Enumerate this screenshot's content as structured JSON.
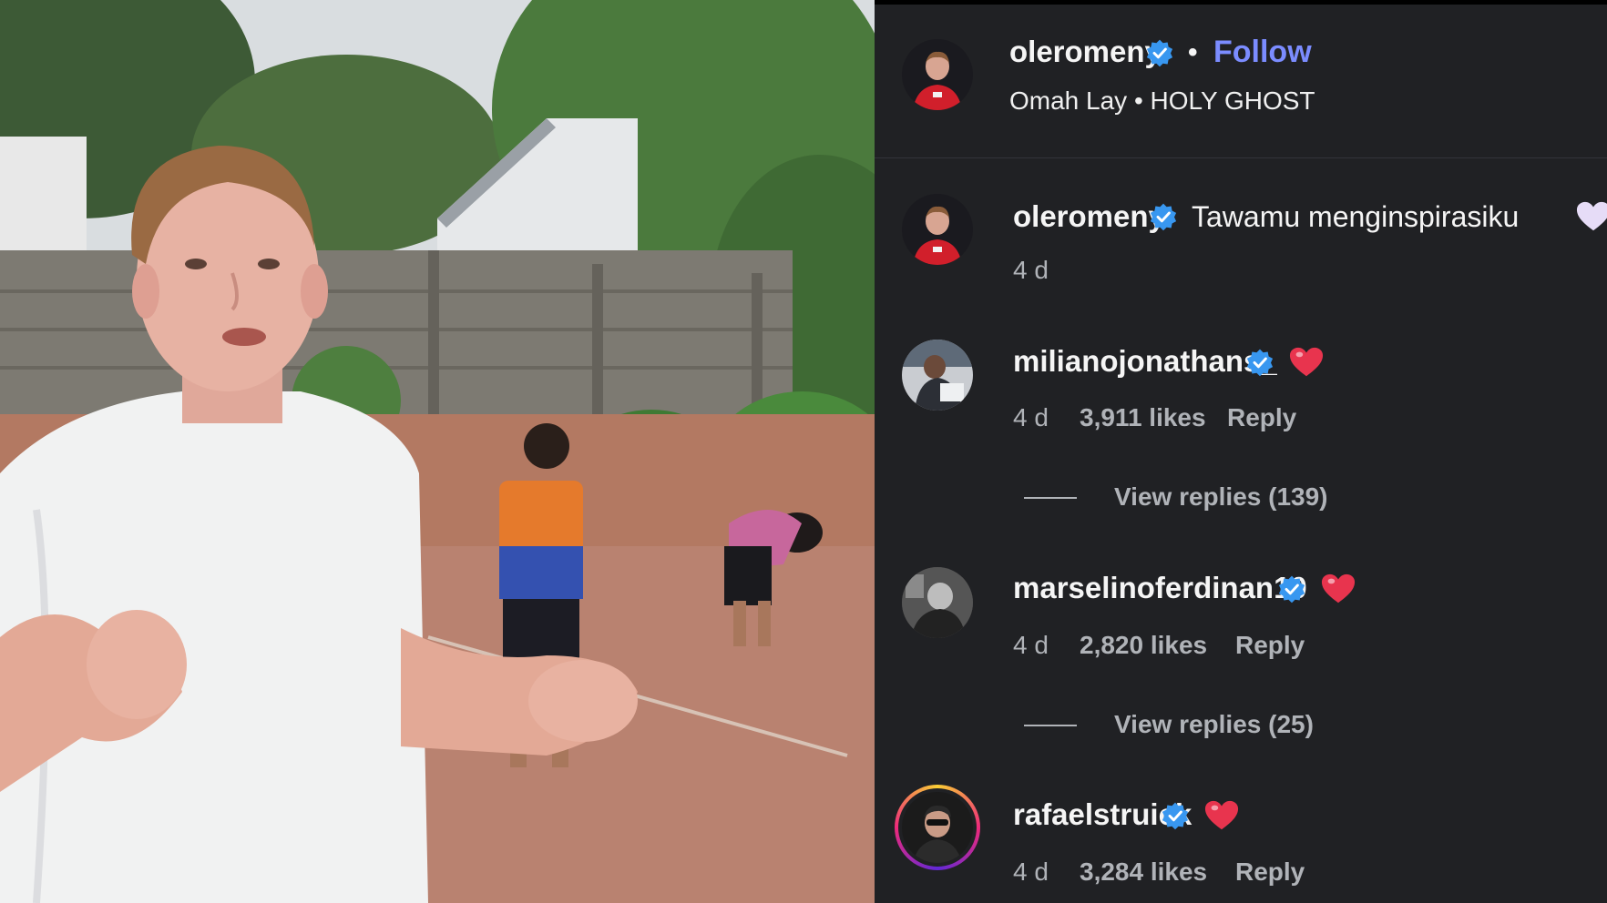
{
  "post": {
    "author": "oleromeny",
    "separator": "•",
    "follow_label": "Follow",
    "music": "Omah Lay • HOLY GHOST"
  },
  "comments": [
    {
      "username": "oleromeny",
      "text": "Tawamu menginspirasiku",
      "emoji": "light-purple-heart",
      "time": "4 d"
    },
    {
      "username": "milianojonathans_",
      "emoji": "red-heart",
      "time": "4 d",
      "likes": "3,911 likes",
      "reply_label": "Reply",
      "view_replies": "View replies (139)"
    },
    {
      "username": "marselinoferdinan10",
      "emoji": "red-heart",
      "time": "4 d",
      "likes": "2,820 likes",
      "reply_label": "Reply",
      "view_replies": "View replies (25)"
    },
    {
      "username": "rafaelstruick",
      "emoji": "red-heart",
      "time": "4 d",
      "likes": "3,284 likes",
      "reply_label": "Reply"
    }
  ],
  "icons": {
    "verified": "verified-badge-icon",
    "heart": "heart-emoji-icon"
  },
  "colors": {
    "panel_bg": "#202124",
    "accent_follow": "#7b8cff",
    "verified_blue": "#3897f0",
    "heart_red": "#e8344e",
    "muted_text": "#b0b3b8"
  }
}
